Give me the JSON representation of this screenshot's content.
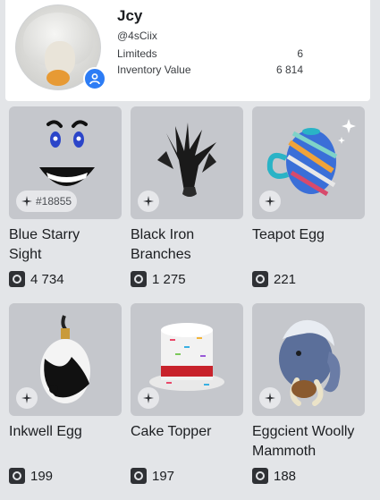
{
  "profile": {
    "name": "Jcy",
    "handle": "@4sCiix",
    "limiteds_label": "Limiteds",
    "limiteds_value": "6",
    "inventory_label": "Inventory Value",
    "inventory_value": "6 814"
  },
  "colors": {
    "accent": "#2c7cf5",
    "card": "#c5c7cc",
    "background": "#e3e5e8"
  },
  "items": [
    {
      "name_line1": "Blue Starry",
      "name_line2": "Sight",
      "price": "4 734",
      "serial": "#18855"
    },
    {
      "name_line1": "Black Iron",
      "name_line2": "Branches",
      "price": "1 275"
    },
    {
      "name_line1": "Teapot Egg",
      "name_line2": "",
      "price": "221"
    },
    {
      "name_line1": "Inkwell Egg",
      "name_line2": "",
      "price": "199"
    },
    {
      "name_line1": "Cake Topper",
      "name_line2": "",
      "price": "197"
    },
    {
      "name_line1": "Eggcient Woolly",
      "name_line2": "Mammoth",
      "price": "188"
    }
  ]
}
